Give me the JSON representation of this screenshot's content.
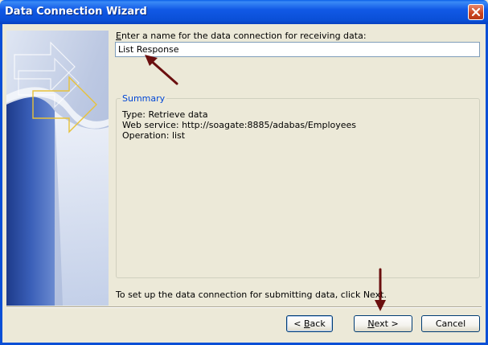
{
  "window": {
    "title": "Data Connection Wizard"
  },
  "form": {
    "prompt_label": "Enter a name for the data connection for receiving data:",
    "prompt_underline_char": "E",
    "prompt_rest": "nter a name for the data connection for receiving data:",
    "name_value": "List Response"
  },
  "summary": {
    "legend": "Summary",
    "lines": [
      "Type: Retrieve data",
      "Web service: http://soagate:8885/adabas/Employees",
      "Operation: list"
    ]
  },
  "footer": {
    "hint": "To set up the data connection for submitting data, click Next."
  },
  "buttons": {
    "back_prefix": "< ",
    "back_key": "B",
    "back_rest": "ack",
    "next_key": "N",
    "next_rest": "ext >",
    "cancel": "Cancel"
  },
  "colors": {
    "titlebar": "#0a4fd6",
    "summary_legend": "#0046d5",
    "annotation_arrow": "#6b0f0f"
  },
  "icons": {
    "close": "close-icon",
    "arrow_annotation": "arrow-icon"
  }
}
